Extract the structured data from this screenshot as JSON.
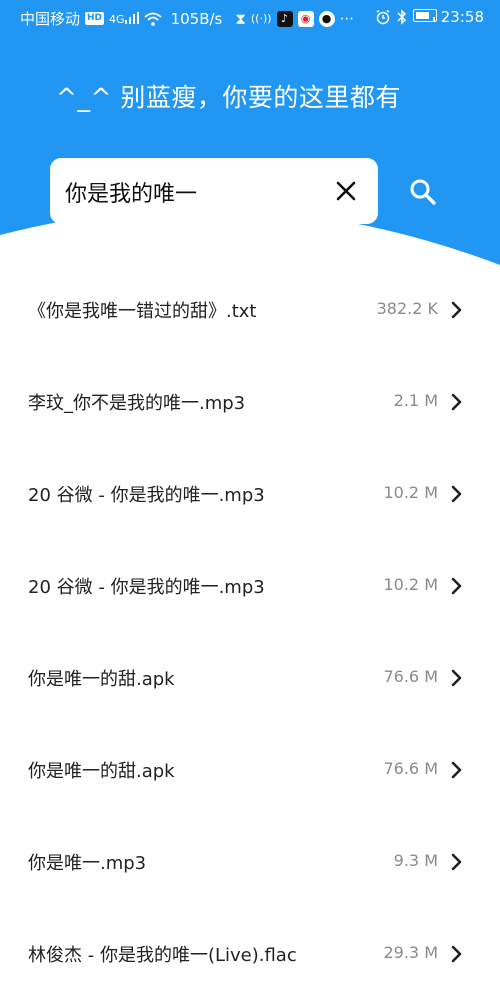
{
  "status_bar": {
    "carrier": "中国移动",
    "hd_badge": "HD",
    "network_type": "4G",
    "speed": "105B/s",
    "time": "23:58",
    "app_icons": [
      "hourglass-icon",
      "hotspot-icon",
      "tiktok-icon",
      "weibo-icon",
      "qq-icon"
    ],
    "system_icons": [
      "alarm-icon",
      "bluetooth-icon",
      "battery-icon"
    ]
  },
  "header": {
    "slogan": "^_^ 别蓝瘦，你要的这里都有",
    "background_color": "#2196F3"
  },
  "search": {
    "query": "你是我的唯一",
    "clear_icon": "close-icon",
    "search_icon": "search-icon"
  },
  "results": [
    {
      "name": "《你是我唯一错过的甜》.txt",
      "size": "382.2 K"
    },
    {
      "name": "李玟_你不是我的唯一.mp3",
      "size": "2.1 M"
    },
    {
      "name": "20 谷微 - 你是我的唯一.mp3",
      "size": "10.2 M"
    },
    {
      "name": "20 谷微 - 你是我的唯一.mp3",
      "size": "10.2 M"
    },
    {
      "name": "你是唯一的甜.apk",
      "size": "76.6 M"
    },
    {
      "name": "你是唯一的甜.apk",
      "size": "76.6 M"
    },
    {
      "name": "你是唯一.mp3",
      "size": "9.3 M"
    },
    {
      "name": "林俊杰 - 你是我的唯一(Live).flac",
      "size": "29.3 M"
    }
  ]
}
